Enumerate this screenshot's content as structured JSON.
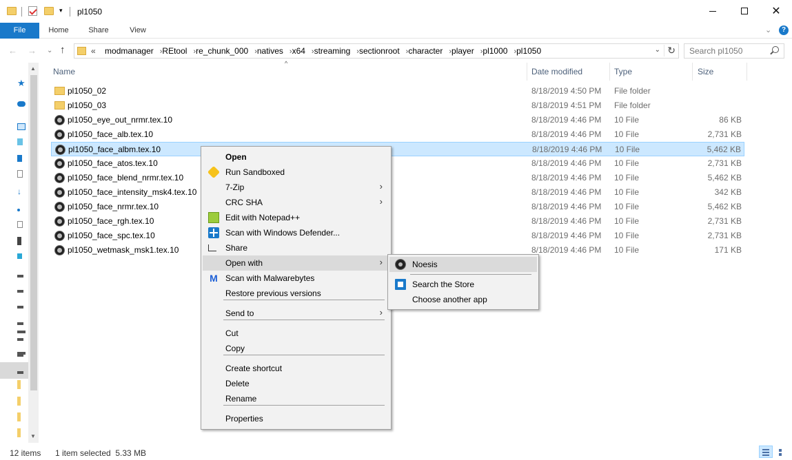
{
  "window": {
    "title": "pl1050",
    "minimize": "—",
    "maximize": "",
    "close": "✕"
  },
  "ribbon": {
    "tabs": [
      "File",
      "Home",
      "Share",
      "View"
    ],
    "expand": "⌄",
    "help": "?"
  },
  "nav": {
    "back": "←",
    "forward": "→",
    "recent": "⌄",
    "up": "↑"
  },
  "address": {
    "overflow": "«",
    "crumbs": [
      "modmanager",
      "REtool",
      "re_chunk_000",
      "natives",
      "x64",
      "streaming",
      "sectionroot",
      "character",
      "player",
      "pl1000",
      "pl1050"
    ],
    "separator": "›",
    "dropdown": "⌄",
    "refresh": "↻"
  },
  "search": {
    "placeholder": "Search pl1050"
  },
  "columns": {
    "name": "Name",
    "date": "Date modified",
    "type": "Type",
    "size": "Size",
    "sort_indicator": "^"
  },
  "files": [
    {
      "name": "pl1050_02",
      "date": "8/18/2019 4:50 PM",
      "type": "File folder",
      "size": "",
      "icon": "folder-icon"
    },
    {
      "name": "pl1050_03",
      "date": "8/18/2019 4:51 PM",
      "type": "File folder",
      "size": "",
      "icon": "folder-icon"
    },
    {
      "name": "pl1050_eye_out_nrmr.tex.10",
      "date": "8/18/2019 4:46 PM",
      "type": "10 File",
      "size": "86 KB",
      "icon": "noesis-file-icon"
    },
    {
      "name": "pl1050_face_alb.tex.10",
      "date": "8/18/2019 4:46 PM",
      "type": "10 File",
      "size": "2,731 KB",
      "icon": "noesis-file-icon"
    },
    {
      "name": "pl1050_face_albm.tex.10",
      "date": "8/18/2019 4:46 PM",
      "type": "10 File",
      "size": "5,462 KB",
      "icon": "noesis-file-icon"
    },
    {
      "name": "pl1050_face_atos.tex.10",
      "date": "8/18/2019 4:46 PM",
      "type": "10 File",
      "size": "2,731 KB",
      "icon": "noesis-file-icon"
    },
    {
      "name": "pl1050_face_blend_nrmr.tex.10",
      "date": "8/18/2019 4:46 PM",
      "type": "10 File",
      "size": "5,462 KB",
      "icon": "noesis-file-icon"
    },
    {
      "name": "pl1050_face_intensity_msk4.tex.10",
      "date": "8/18/2019 4:46 PM",
      "type": "10 File",
      "size": "342 KB",
      "icon": "noesis-file-icon"
    },
    {
      "name": "pl1050_face_nrmr.tex.10",
      "date": "8/18/2019 4:46 PM",
      "type": "10 File",
      "size": "5,462 KB",
      "icon": "noesis-file-icon"
    },
    {
      "name": "pl1050_face_rgh.tex.10",
      "date": "8/18/2019 4:46 PM",
      "type": "10 File",
      "size": "2,731 KB",
      "icon": "noesis-file-icon"
    },
    {
      "name": "pl1050_face_spc.tex.10",
      "date": "8/18/2019 4:46 PM",
      "type": "10 File",
      "size": "2,731 KB",
      "icon": "noesis-file-icon"
    },
    {
      "name": "pl1050_wetmask_msk1.tex.10",
      "date": "8/18/2019 4:46 PM",
      "type": "10 File",
      "size": "171 KB",
      "icon": "noesis-file-icon"
    }
  ],
  "selected_index": 4,
  "context_menu": {
    "items": [
      {
        "label": "Open",
        "bold": true,
        "icon": ""
      },
      {
        "label": "Run Sandboxed",
        "icon": "sandboxie-icon"
      },
      {
        "label": "7-Zip",
        "submenu": true,
        "icon": ""
      },
      {
        "label": "CRC SHA",
        "submenu": true,
        "icon": ""
      },
      {
        "label": "Edit with Notepad++",
        "icon": "notepad-plus-plus-icon"
      },
      {
        "label": "Scan with Windows Defender...",
        "icon": "windows-defender-icon"
      },
      {
        "label": "Share",
        "icon": "share-icon"
      },
      {
        "label": "Open with",
        "submenu": true,
        "highlighted": true,
        "icon": ""
      },
      {
        "label": "Scan with Malwarebytes",
        "icon": "malwarebytes-icon"
      },
      {
        "label": "Restore previous versions",
        "icon": ""
      },
      {
        "label": "Send to",
        "submenu": true,
        "icon": ""
      },
      {
        "label": "Cut",
        "icon": ""
      },
      {
        "label": "Copy",
        "icon": ""
      },
      {
        "label": "Create shortcut",
        "icon": ""
      },
      {
        "label": "Delete",
        "icon": ""
      },
      {
        "label": "Rename",
        "icon": ""
      },
      {
        "label": "Properties",
        "icon": ""
      }
    ],
    "submenu_arrow": "›"
  },
  "open_with_menu": {
    "items": [
      {
        "label": "Noesis",
        "icon": "noesis-icon",
        "highlighted": true
      },
      {
        "label": "Search the Store",
        "icon": "store-icon"
      },
      {
        "label": "Choose another app",
        "icon": ""
      }
    ]
  },
  "status": {
    "item_count": "12 items",
    "selection": "1 item selected  5.33 MB"
  },
  "colors": {
    "accent": "#1979ca",
    "selection_bg": "#cce8ff",
    "selection_border": "#99d1ff",
    "menu_bg": "#f2f2f2",
    "menu_highlight": "#dadada"
  }
}
